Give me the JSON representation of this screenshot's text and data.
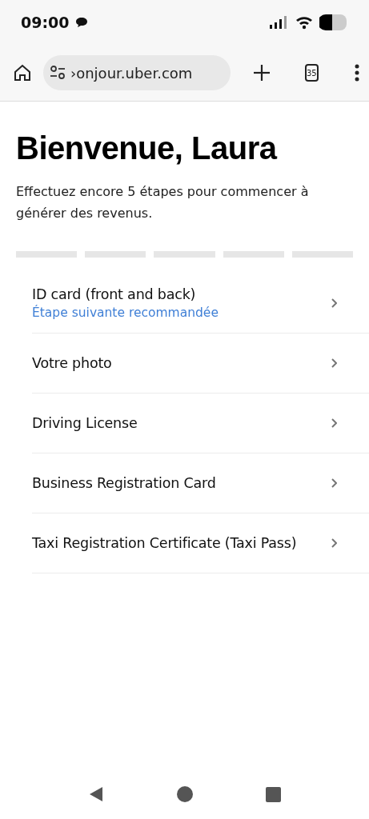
{
  "status_bar": {
    "time": "09:00"
  },
  "browser": {
    "url": "›onjour.uber.com",
    "tab_count": "35"
  },
  "title": "Bienvenue, Laura",
  "intro": "Effectuez encore 5 étapes pour commencer à générer des revenus.",
  "progress": [
    {
      "completed": false
    },
    {
      "completed": false
    },
    {
      "completed": false
    },
    {
      "completed": false
    },
    {
      "completed": false
    }
  ],
  "steps": [
    {
      "label": "ID card (front and back)",
      "hint": "Étape suivante recommandée"
    },
    {
      "label": "Votre photo"
    },
    {
      "label": "Driving License"
    },
    {
      "label": "Business Registration Card"
    },
    {
      "label": "Taxi Registration Certificate (Taxi Pass)"
    }
  ]
}
